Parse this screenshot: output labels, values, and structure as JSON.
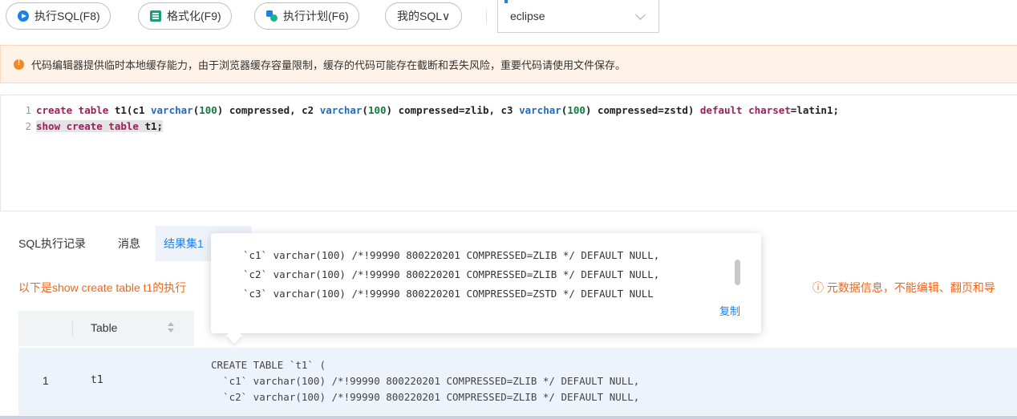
{
  "toolbar": {
    "run_sql": "执行SQL(F8)",
    "format": "格式化(F9)",
    "exec_plan": "执行计划(F6)",
    "my_sql": "我的SQL∨",
    "database": "eclipse"
  },
  "warning": {
    "text": "代码编辑器提供临时本地缓存能力，由于浏览器缓存容量限制，缓存的代码可能存在截断和丢失风险，重要代码请使用文件保存。"
  },
  "editor": {
    "lines": [
      {
        "num": "1",
        "tokens": [
          {
            "t": "create table ",
            "c": "kw"
          },
          {
            "t": "t1(c1 ",
            "c": ""
          },
          {
            "t": "varchar",
            "c": "ty"
          },
          {
            "t": "(",
            "c": ""
          },
          {
            "t": "100",
            "c": "nm"
          },
          {
            "t": ") compressed, c2 ",
            "c": ""
          },
          {
            "t": "varchar",
            "c": "ty"
          },
          {
            "t": "(",
            "c": ""
          },
          {
            "t": "100",
            "c": "nm"
          },
          {
            "t": ") compressed=zlib, c3 ",
            "c": ""
          },
          {
            "t": "varchar",
            "c": "ty"
          },
          {
            "t": "(",
            "c": ""
          },
          {
            "t": "100",
            "c": "nm"
          },
          {
            "t": ") compressed=zstd) ",
            "c": ""
          },
          {
            "t": "default charset",
            "c": "kw"
          },
          {
            "t": "=latin1;",
            "c": ""
          }
        ]
      },
      {
        "num": "2",
        "tokens": [
          {
            "t": "show create table ",
            "c": "kw"
          },
          {
            "t": "t1;",
            "c": ""
          }
        ]
      }
    ]
  },
  "tabs": {
    "history": "SQL执行记录",
    "messages": "消息",
    "result": "结果集1"
  },
  "result": {
    "info": "以下是show create table t1的执行",
    "meta": "ⓘ 元数据信息，不能编辑、翻页和导",
    "column_header": "Table",
    "row_index": "1",
    "row_table": "t1",
    "row_ddl": "CREATE TABLE `t1` (\n  `c1` varchar(100) /*!99990 800220201 COMPRESSED=ZLIB */ DEFAULT NULL,\n  `c2` varchar(100) /*!99990 800220201 COMPRESSED=ZLIB */ DEFAULT NULL,"
  },
  "popover": {
    "lines": [
      "`c1` varchar(100) /*!99990 800220201 COMPRESSED=ZLIB */ DEFAULT NULL,",
      "`c2` varchar(100) /*!99990 800220201 COMPRESSED=ZLIB */ DEFAULT NULL,",
      "`c3` varchar(100) /*!99990 800220201 COMPRESSED=ZSTD */ DEFAULT NULL"
    ],
    "copy": "复制"
  }
}
